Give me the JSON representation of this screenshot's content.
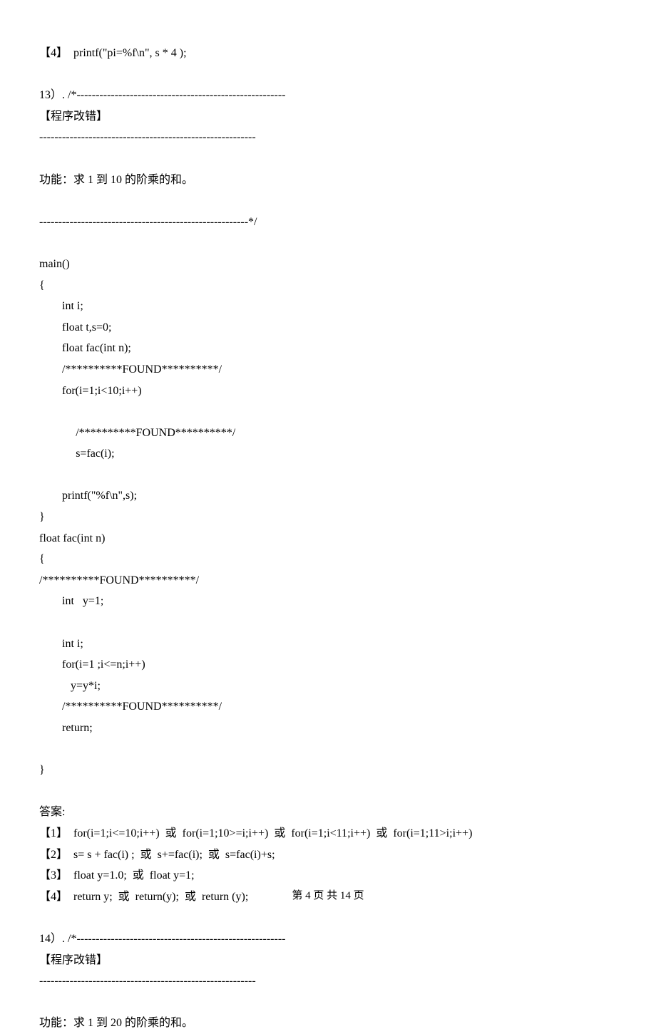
{
  "lines": [
    {
      "cls": "",
      "text": "【4】  printf(\"pi=%f\\n\", s * 4 );"
    },
    {
      "cls": "spacer",
      "text": ""
    },
    {
      "cls": "",
      "text": "13）. /*-------------------------------------------------------"
    },
    {
      "cls": "",
      "text": "【程序改错】"
    },
    {
      "cls": "",
      "text": "---------------------------------------------------------"
    },
    {
      "cls": "spacer",
      "text": ""
    },
    {
      "cls": "",
      "text": "功能：求 1 到 10 的阶乘的和。"
    },
    {
      "cls": "spacer",
      "text": ""
    },
    {
      "cls": "",
      "text": "-------------------------------------------------------*/"
    },
    {
      "cls": "spacer",
      "text": ""
    },
    {
      "cls": "",
      "text": "main()"
    },
    {
      "cls": "",
      "text": "{"
    },
    {
      "cls": "indent1",
      "text": "int i;"
    },
    {
      "cls": "indent1",
      "text": "float t,s=0;"
    },
    {
      "cls": "indent1",
      "text": "float fac(int n);"
    },
    {
      "cls": "indent1",
      "text": "/**********FOUND**********/"
    },
    {
      "cls": "indent1",
      "text": "for(i=1;i<10;i++)"
    },
    {
      "cls": "spacer",
      "text": ""
    },
    {
      "cls": "indent2",
      "text": "/**********FOUND**********/"
    },
    {
      "cls": "indent2",
      "text": "s=fac(i);"
    },
    {
      "cls": "spacer",
      "text": ""
    },
    {
      "cls": "indent1",
      "text": "printf(\"%f\\n\",s);"
    },
    {
      "cls": "",
      "text": "}"
    },
    {
      "cls": "",
      "text": "float fac(int n)"
    },
    {
      "cls": "",
      "text": "{"
    },
    {
      "cls": "",
      "text": "/**********FOUND**********/"
    },
    {
      "cls": "indent1",
      "text": "int   y=1;"
    },
    {
      "cls": "spacer",
      "text": ""
    },
    {
      "cls": "indent1",
      "text": "int i;"
    },
    {
      "cls": "indent1",
      "text": "for(i=1 ;i<=n;i++)"
    },
    {
      "cls": "indent1",
      "text": "   y=y*i;"
    },
    {
      "cls": "indent1",
      "text": "/**********FOUND**********/"
    },
    {
      "cls": "indent1",
      "text": "return;"
    },
    {
      "cls": "spacer",
      "text": ""
    },
    {
      "cls": "",
      "text": "}"
    },
    {
      "cls": "spacer",
      "text": ""
    },
    {
      "cls": "",
      "text": "答案:"
    },
    {
      "cls": "",
      "text": "【1】  for(i=1;i<=10;i++)  或  for(i=1;10>=i;i++)  或  for(i=1;i<11;i++)  或  for(i=1;11>i;i++)"
    },
    {
      "cls": "",
      "text": "【2】  s= s + fac(i) ;  或  s+=fac(i);  或  s=fac(i)+s;"
    },
    {
      "cls": "",
      "text": "【3】  float y=1.0;  或  float y=1;"
    },
    {
      "cls": "",
      "text": "【4】  return y;  或  return(y);  或  return (y);"
    },
    {
      "cls": "spacer",
      "text": ""
    },
    {
      "cls": "",
      "text": "14）. /*-------------------------------------------------------"
    },
    {
      "cls": "",
      "text": "【程序改错】"
    },
    {
      "cls": "",
      "text": "---------------------------------------------------------"
    },
    {
      "cls": "spacer",
      "text": ""
    },
    {
      "cls": "",
      "text": "功能：求 1 到 20 的阶乘的和。"
    }
  ],
  "footer": "第 4 页    共 14 页"
}
